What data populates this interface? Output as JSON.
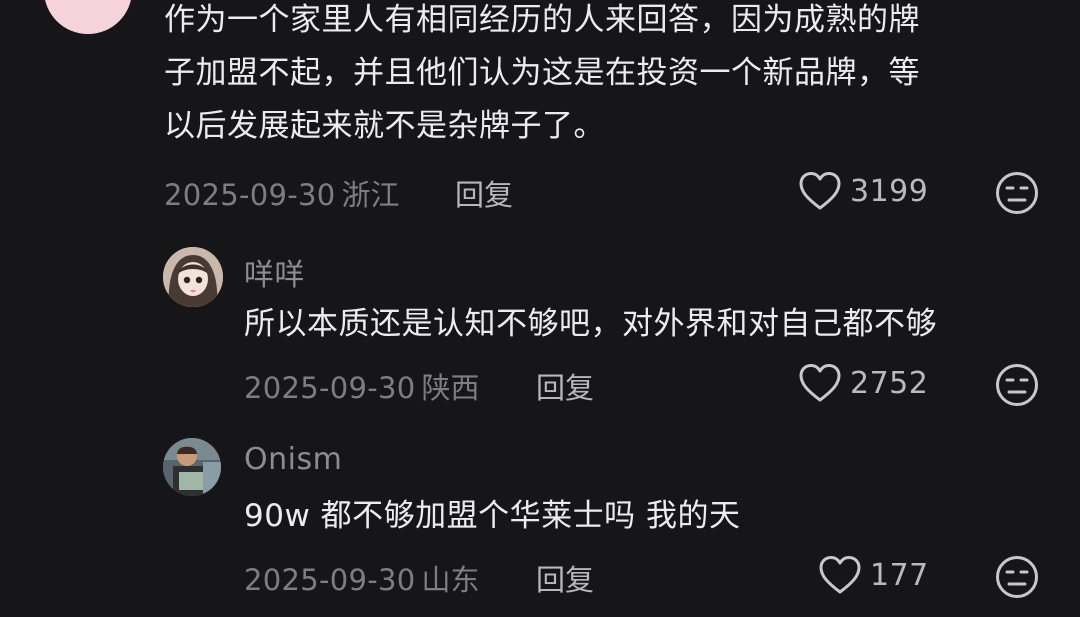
{
  "comments": [
    {
      "username": "",
      "text_lines": [
        "作为一个家里人有相同经历的人来回答，因为成熟的牌",
        "子加盟不起，并且他们认为这是在投资一个新品牌，等",
        "以后发展起来就不是杂牌子了。"
      ],
      "date": "2025-09-30",
      "location": "浙江",
      "reply_label": "回复",
      "likes": "3199",
      "like_icon": "heart-outline-icon",
      "dislike_icon": "unhappy-face-icon"
    },
    {
      "username": "咩咩",
      "text_lines": [
        "所以本质还是认知不够吧，对外界和对自己都不够"
      ],
      "date": "2025-09-30",
      "location": "陕西",
      "reply_label": "回复",
      "likes": "2752",
      "like_icon": "heart-outline-icon",
      "dislike_icon": "unhappy-face-icon"
    },
    {
      "username": "Onism",
      "text_lines": [
        "90w 都不够加盟个华莱士吗 我的天"
      ],
      "date": "2025-09-30",
      "location": "山东",
      "reply_label": "回复",
      "likes": "177",
      "like_icon": "heart-outline-icon",
      "dislike_icon": "unhappy-face-icon"
    }
  ],
  "colors": {
    "background": "#161618",
    "text": "#ececef",
    "meta": "#7d7d82",
    "icon": "#c8c8cc"
  }
}
